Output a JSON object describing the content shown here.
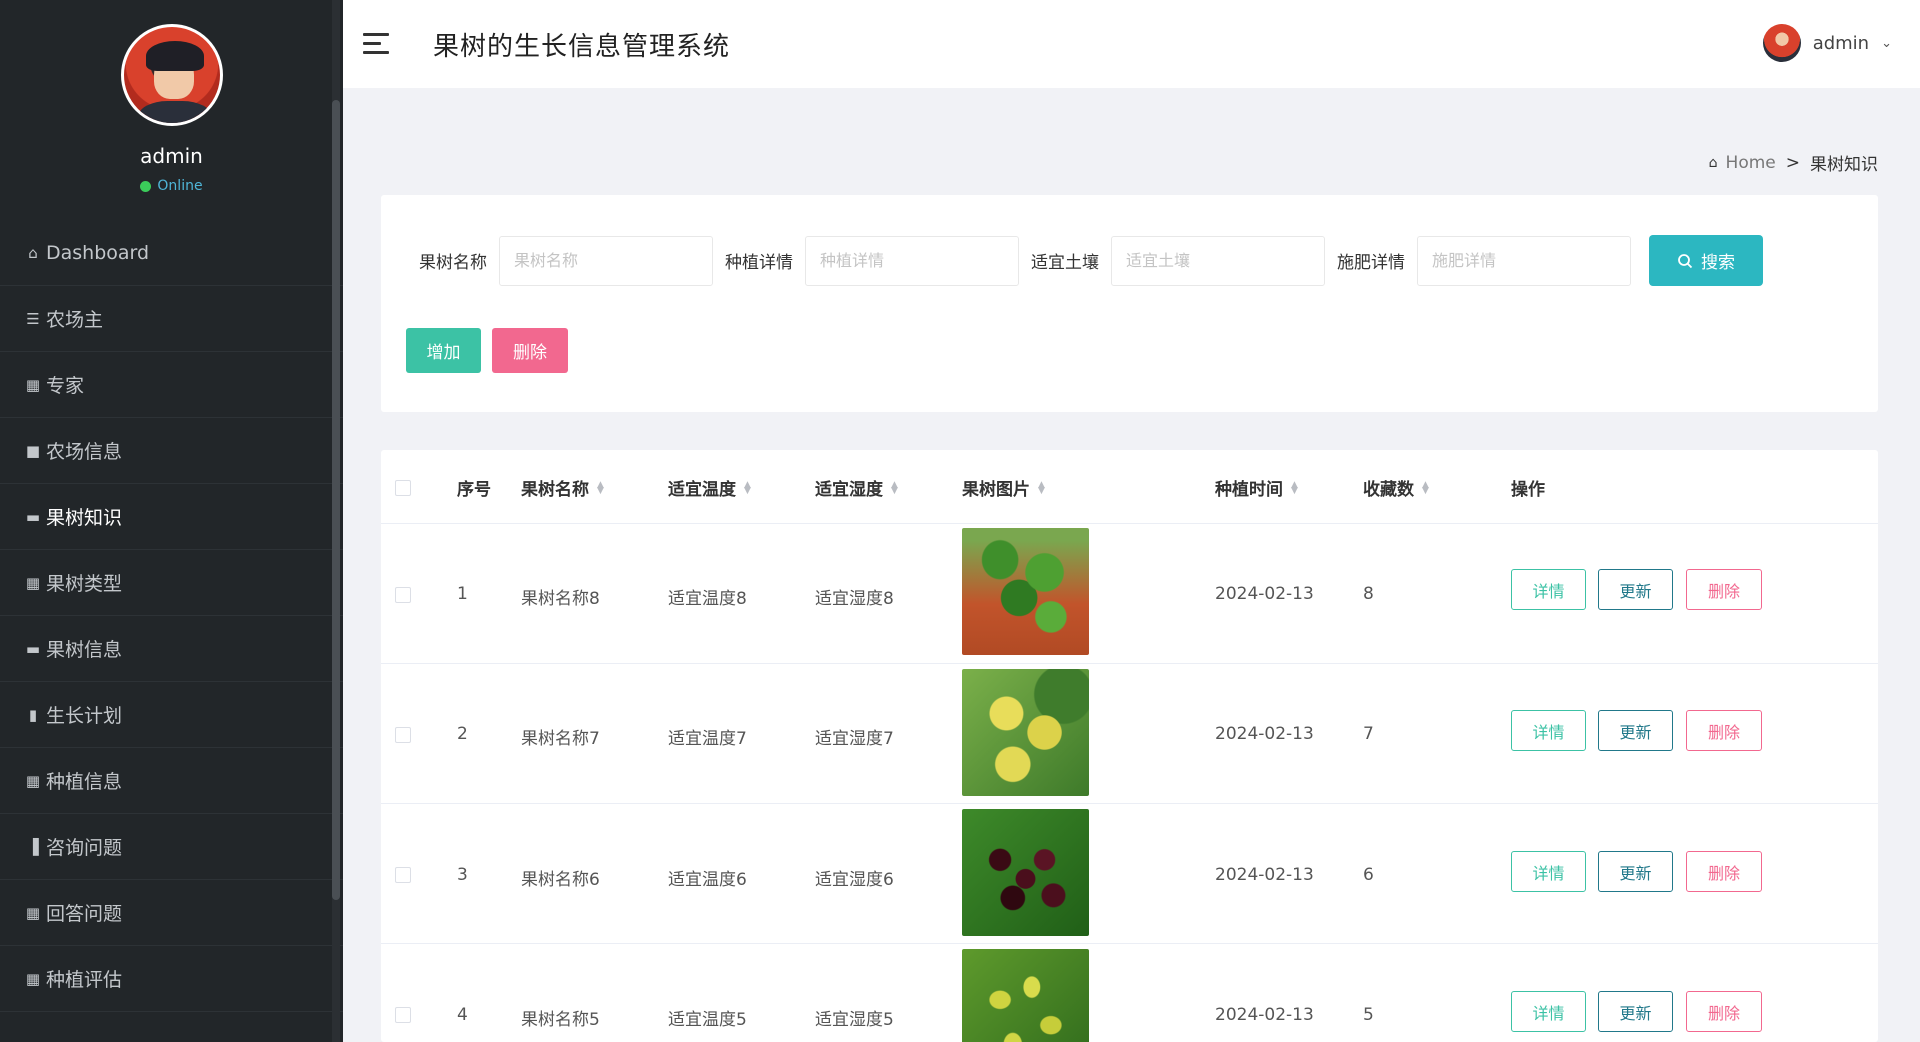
{
  "header": {
    "title": "果树的生长信息管理系统",
    "user": "admin"
  },
  "profile": {
    "name": "admin",
    "status": "Online"
  },
  "sidebar": {
    "items": [
      {
        "label": "Dashboard",
        "icon": "home-icon"
      },
      {
        "label": "农场主",
        "icon": "list-icon"
      },
      {
        "label": "专家",
        "icon": "grid-icon"
      },
      {
        "label": "农场信息",
        "icon": "camera-icon"
      },
      {
        "label": "果树知识",
        "icon": "briefcase-icon"
      },
      {
        "label": "果树类型",
        "icon": "grid-icon"
      },
      {
        "label": "果树信息",
        "icon": "monitor-icon"
      },
      {
        "label": "生长计划",
        "icon": "book-icon"
      },
      {
        "label": "种植信息",
        "icon": "grid-icon"
      },
      {
        "label": "咨询问题",
        "icon": "bar-chart-icon"
      },
      {
        "label": "回答问题",
        "icon": "grid-icon"
      },
      {
        "label": "种植评估",
        "icon": "grid-icon"
      }
    ]
  },
  "breadcrumb": {
    "home": "Home",
    "separator": ">",
    "current": "果树知识"
  },
  "search": {
    "fields": [
      {
        "label": "果树名称",
        "placeholder": "果树名称"
      },
      {
        "label": "种植详情",
        "placeholder": "种植详情"
      },
      {
        "label": "适宜土壤",
        "placeholder": "适宜土壤"
      },
      {
        "label": "施肥详情",
        "placeholder": "施肥详情"
      }
    ],
    "button": "搜索"
  },
  "actions": {
    "add": "增加",
    "delete": "删除"
  },
  "table": {
    "columns": [
      "序号",
      "果树名称",
      "适宜温度",
      "适宜湿度",
      "果树图片",
      "种植时间",
      "收藏数",
      "操作"
    ],
    "rows": [
      {
        "index": "1",
        "name": "果树名称8",
        "temp": "适宜温度8",
        "humidity": "适宜湿度8",
        "image": "fruit-tree-sapling",
        "date": "2024-02-13",
        "favorites": "8"
      },
      {
        "index": "2",
        "name": "果树名称7",
        "temp": "适宜温度7",
        "humidity": "适宜湿度7",
        "image": "yellow-fruit",
        "date": "2024-02-13",
        "favorites": "7"
      },
      {
        "index": "3",
        "name": "果树名称6",
        "temp": "适宜温度6",
        "humidity": "适宜湿度6",
        "image": "dark-cherries",
        "date": "2024-02-13",
        "favorites": "6"
      },
      {
        "index": "4",
        "name": "果树名称5",
        "temp": "适宜温度5",
        "humidity": "适宜湿度5",
        "image": "jujube-tree",
        "date": "2024-02-13",
        "favorites": "5"
      }
    ],
    "op_labels": {
      "detail": "详情",
      "update": "更新",
      "delete": "删除"
    }
  },
  "colors": {
    "sidebar_bg": "#222629",
    "primary": "#2cb7c1",
    "success": "#3cc2a5",
    "danger": "#f2688f",
    "update": "#21788a"
  }
}
